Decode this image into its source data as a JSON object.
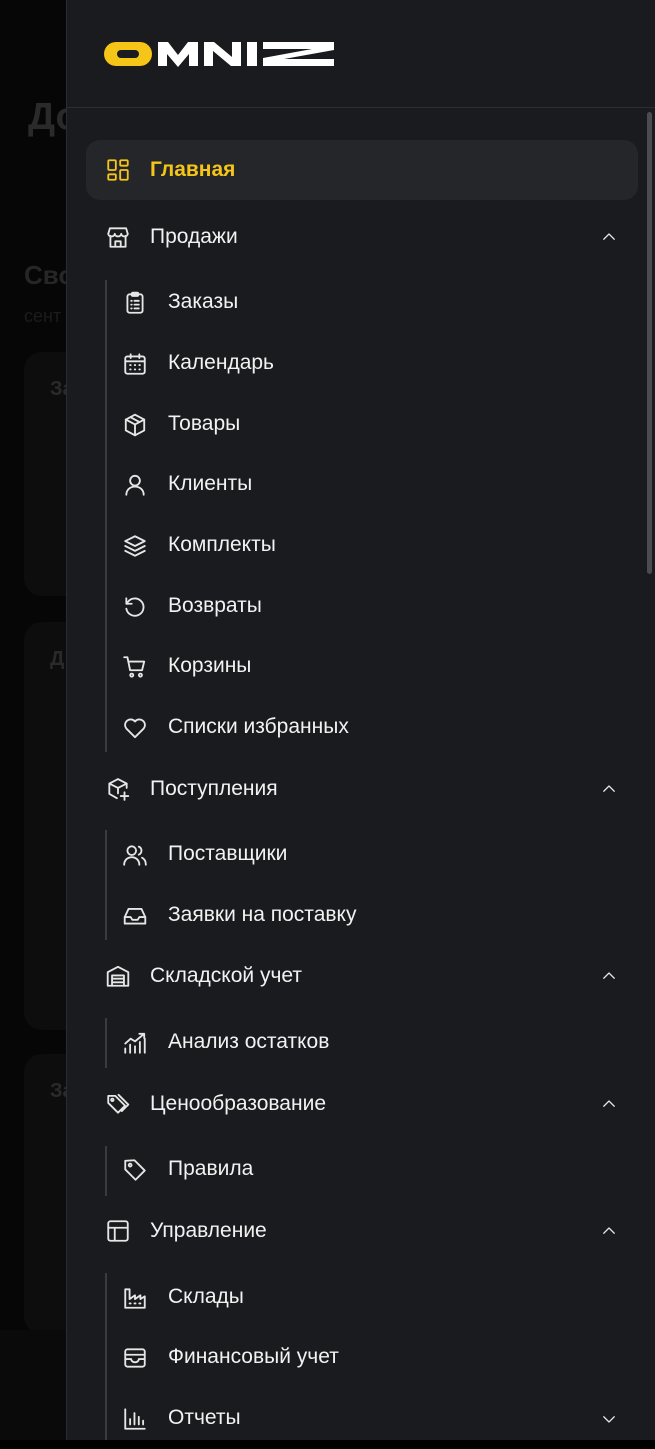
{
  "background": {
    "title": "До",
    "section_title": "Сво",
    "section_subtitle": "сент",
    "card_labels": [
      "За",
      "Д",
      "За"
    ]
  },
  "brand": {
    "name": "OMNIZ",
    "accent": "#f5c518"
  },
  "nav": {
    "home": {
      "label": "Главная",
      "icon": "grid-icon",
      "active": true
    },
    "sales": {
      "label": "Продажи",
      "icon": "store-icon",
      "expanded": true,
      "items": [
        {
          "label": "Заказы",
          "icon": "clipboard-list-icon"
        },
        {
          "label": "Календарь",
          "icon": "calendar-icon"
        },
        {
          "label": "Товары",
          "icon": "box-icon"
        },
        {
          "label": "Клиенты",
          "icon": "user-icon"
        },
        {
          "label": "Комплекты",
          "icon": "layers-icon"
        },
        {
          "label": "Возвраты",
          "icon": "rotate-ccw-icon"
        },
        {
          "label": "Корзины",
          "icon": "cart-icon"
        },
        {
          "label": "Списки избранных",
          "icon": "heart-icon"
        }
      ]
    },
    "receipts": {
      "label": "Поступления",
      "icon": "package-plus-icon",
      "expanded": true,
      "items": [
        {
          "label": "Поставщики",
          "icon": "users-icon"
        },
        {
          "label": "Заявки на поставку",
          "icon": "inbox-icon"
        }
      ]
    },
    "warehouse": {
      "label": "Складской учет",
      "icon": "warehouse-icon",
      "expanded": true,
      "items": [
        {
          "label": "Анализ остатков",
          "icon": "trend-chart-icon"
        }
      ]
    },
    "pricing": {
      "label": "Ценообразование",
      "icon": "tags-icon",
      "expanded": true,
      "items": [
        {
          "label": "Правила",
          "icon": "tag-icon"
        }
      ]
    },
    "management": {
      "label": "Управление",
      "icon": "layout-icon",
      "expanded": true,
      "items": [
        {
          "label": "Склады",
          "icon": "factory-icon"
        },
        {
          "label": "Финансовый учет",
          "icon": "wallet-icon"
        },
        {
          "label": "Отчеты",
          "icon": "bar-chart-icon",
          "expandable": true,
          "expanded": false
        }
      ]
    }
  }
}
